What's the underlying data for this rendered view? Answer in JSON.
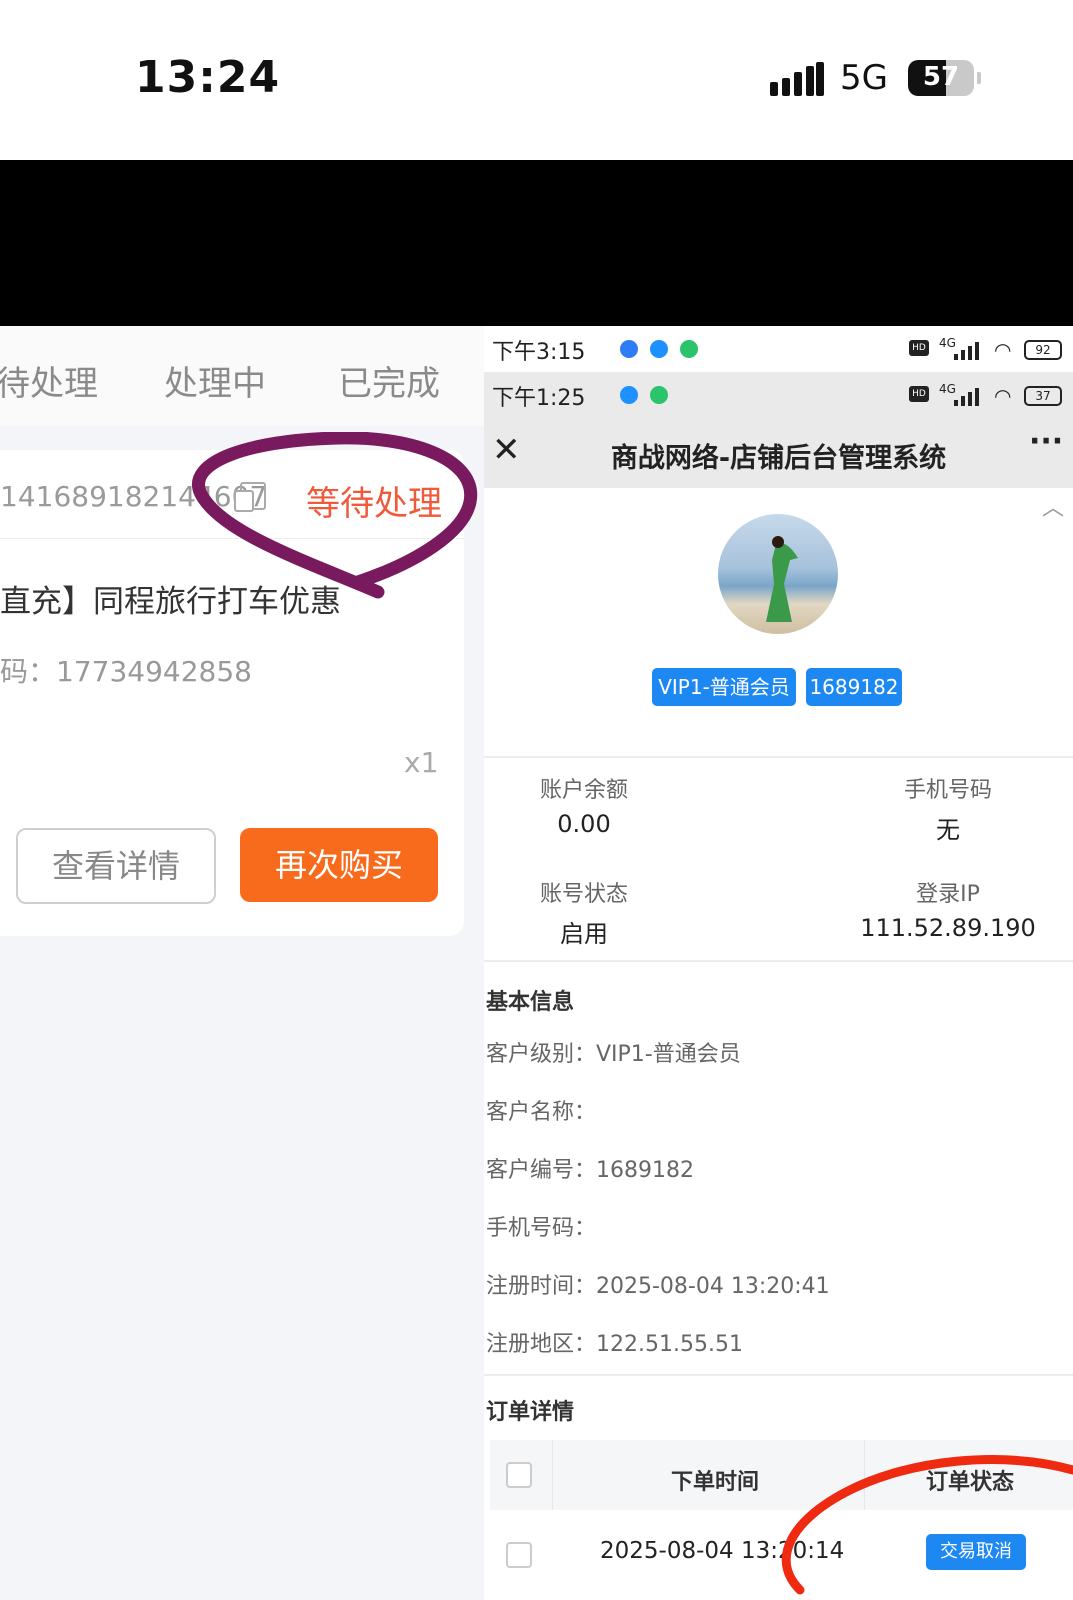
{
  "status_bar": {
    "time": "13:24",
    "network": "5G",
    "battery": "57",
    "battery_level": 0.57
  },
  "left": {
    "tabs": [
      "待处理",
      "处理中",
      "已完成"
    ],
    "order": {
      "order_no": "141689182144607",
      "status": "等待处理",
      "title": "直充】同程旅行打车优惠",
      "account": "码：17734942858",
      "quantity": "x1",
      "btn_detail": "查看详情",
      "btn_rebuy": "再次购买"
    }
  },
  "right": {
    "status_bar_1": {
      "time": "下午3:15",
      "battery": "92"
    },
    "status_bar_2": {
      "time": "下午1:25",
      "battery": "37"
    },
    "nav_title": "商战网络-店铺后台管理系统",
    "badges": [
      "VIP1-普通会员",
      "1689182"
    ],
    "stats": [
      {
        "label": "账户余额",
        "value": "0.00"
      },
      {
        "label": "手机号码",
        "value": "无"
      },
      {
        "label": "账号状态",
        "value": "启用"
      },
      {
        "label": "登录IP",
        "value": "111.52.89.190"
      }
    ],
    "basic_title": "基本信息",
    "basic": [
      "客户级别：VIP1-普通会员",
      "客户名称：",
      "客户编号：1689182",
      "手机号码：",
      "注册时间：2025-08-04 13:20:41",
      "注册地区：122.51.55.51"
    ],
    "order_title": "订单详情",
    "table": {
      "headers": [
        "下单时间",
        "订单状态"
      ],
      "rows": [
        {
          "time": "2025-08-04 13:20:14",
          "status": "交易取消"
        }
      ]
    }
  },
  "colors": {
    "accent_orange": "#f96b1c",
    "status_red": "#ee5a3a",
    "badge_blue": "#1e88f2",
    "purple_mark": "#7a1a5e",
    "red_mark": "#ee2a10"
  }
}
